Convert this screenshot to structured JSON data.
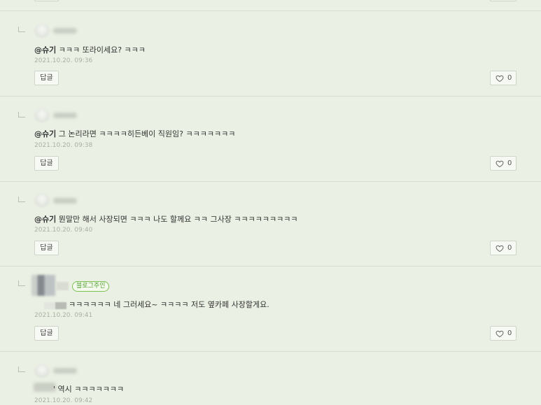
{
  "comments": [
    {
      "mention": "@슈기",
      "text": " ㅋㅋㅋ 또라이세요? ㅋㅋㅋ",
      "date": "2021.10.20. 09:36",
      "reply_label": "답글",
      "like_count": "0"
    },
    {
      "mention": "@슈기",
      "text": " 그 논리라면 ㅋㅋㅋㅋ히든베이 직원임? ㅋㅋㅋㅋㅋㅋㅋ",
      "date": "2021.10.20. 09:38",
      "reply_label": "답글",
      "like_count": "0"
    },
    {
      "mention": "@슈기",
      "text": " 뭔말만 해서 사장되면 ㅋㅋㅋ 나도 할께요 ㅋㅋ 그사장 ㅋㅋㅋㅋㅋㅋㅋㅋㅋ",
      "date": "2021.10.20. 09:40",
      "reply_label": "답글",
      "like_count": "0"
    },
    {
      "badge": "블로그주인",
      "text": "ㅋㅋㅋㅋㅋㅋ 네 그러세요~ ㅋㅋㅋㅋ 저도 옆카페 사장할게요.",
      "date": "2021.10.20. 09:41",
      "reply_label": "답글",
      "like_count": "0"
    },
    {
      "text": "' 역시 ㅋㅋㅋㅋㅋㅋㅋ",
      "date": "2021.10.20. 09:42"
    }
  ]
}
